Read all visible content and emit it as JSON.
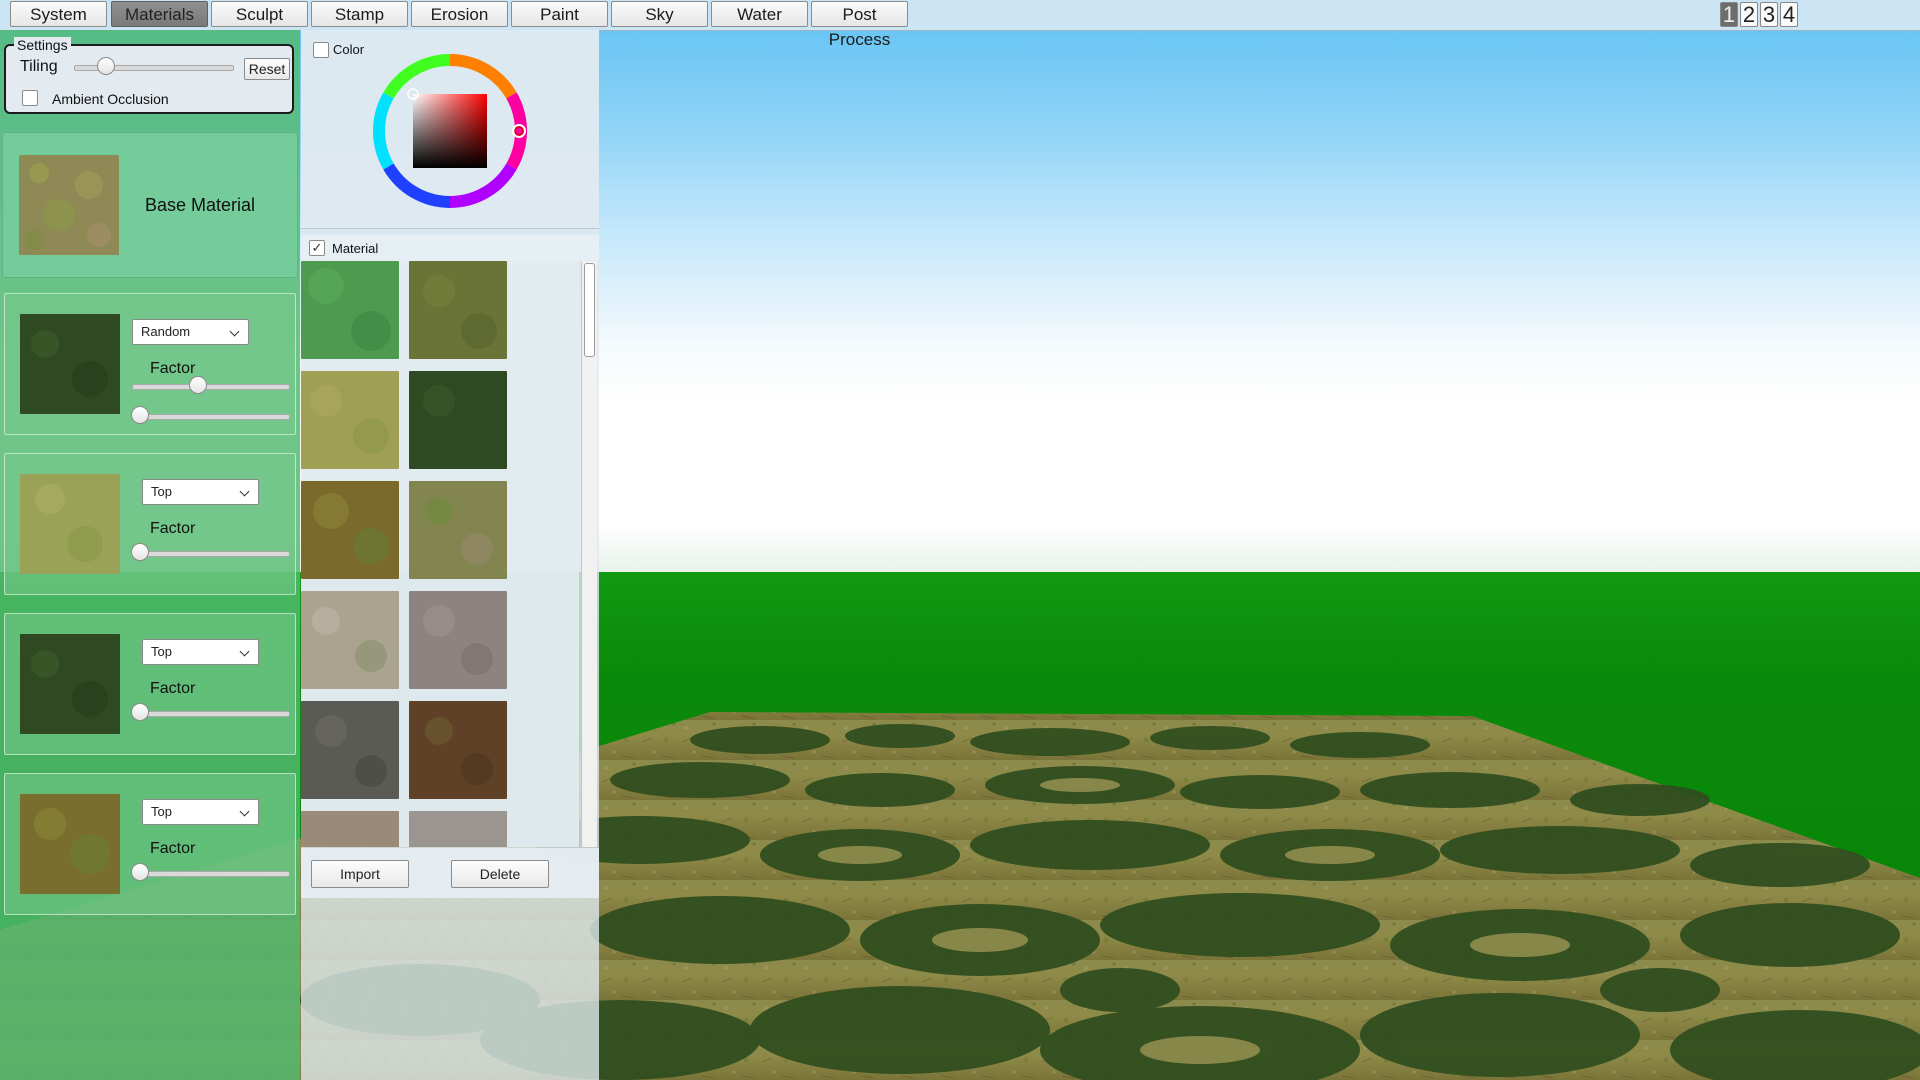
{
  "toolbar": {
    "tabs": [
      {
        "label": "System"
      },
      {
        "label": "Materials",
        "active": true
      },
      {
        "label": "Sculpt"
      },
      {
        "label": "Stamp"
      },
      {
        "label": "Erosion"
      },
      {
        "label": "Paint"
      },
      {
        "label": "Sky"
      },
      {
        "label": "Water"
      },
      {
        "label": "Post Process"
      }
    ],
    "layouts": [
      "1",
      "2",
      "3",
      "4"
    ],
    "active_layout": "1"
  },
  "settings": {
    "title": "Settings",
    "tiling_label": "Tiling",
    "tiling_value": 0.2,
    "reset_label": "Reset",
    "ambient_occlusion_label": "Ambient Occlusion",
    "ambient_occlusion_checked": false
  },
  "base_material": {
    "label": "Base Material",
    "texture_icon": "grass-dirt-texture"
  },
  "layers": [
    {
      "mode": "Random",
      "factor_label": "Factor",
      "factor_value": 0.42,
      "secondary_value": 0.05,
      "texture_icon": "dark-moss-texture"
    },
    {
      "mode": "Top",
      "factor_label": "Factor",
      "factor_value": 0.05,
      "texture_icon": "light-grass-texture"
    },
    {
      "mode": "Top",
      "factor_label": "Factor",
      "factor_value": 0.05,
      "texture_icon": "dark-moss-texture"
    },
    {
      "mode": "Top",
      "factor_label": "Factor",
      "factor_value": 0.05,
      "texture_icon": "mossy-mud-texture"
    }
  ],
  "color": {
    "label": "Color",
    "checked": false,
    "hue_hex": "#ff0000"
  },
  "material_library": {
    "label": "Material",
    "checked": true,
    "tiles": [
      "green-moss-texture",
      "olive-grass-texture",
      "yellow-grass-texture",
      "dark-moss-texture",
      "mossy-mud-texture",
      "patchy-grass-texture",
      "gravel-texture",
      "rock-texture",
      "dark-rock-texture",
      "brown-soil-texture",
      "sand-texture",
      "pebble-texture"
    ],
    "import_label": "Import",
    "delete_label": "Delete"
  },
  "colors": {
    "panel_green": "#52ba70",
    "base_card": "#74cc9b",
    "sky_top": "#5fc1f2",
    "horizon_green": "#119a11"
  }
}
